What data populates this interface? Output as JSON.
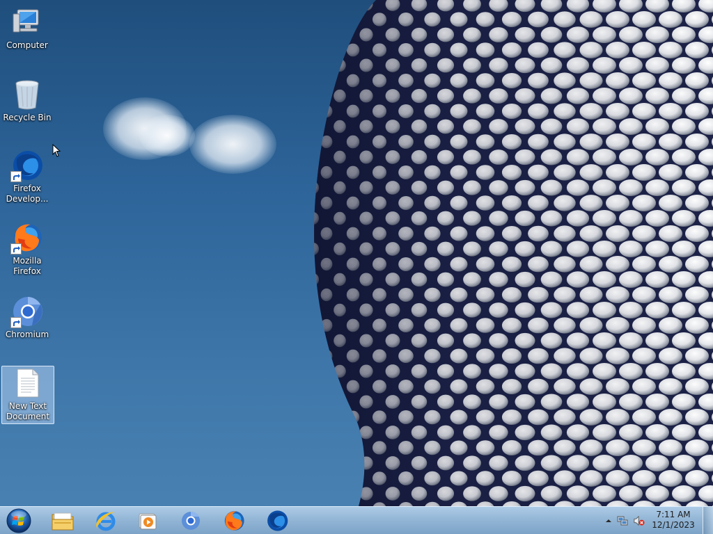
{
  "desktop": {
    "icons": [
      {
        "label": "Computer",
        "icon": "computer-icon",
        "shortcut": false
      },
      {
        "label": "Recycle Bin",
        "icon": "recycle-bin-icon",
        "shortcut": false
      },
      {
        "label": "Firefox\nDevelop...",
        "icon": "firefox-developer-icon",
        "shortcut": true
      },
      {
        "label": "Mozilla\nFirefox",
        "icon": "firefox-icon",
        "shortcut": true
      },
      {
        "label": "Chromium",
        "icon": "chromium-icon",
        "shortcut": true
      },
      {
        "label": "New Text\nDocument",
        "icon": "text-document-icon",
        "shortcut": false,
        "selected": true
      }
    ]
  },
  "taskbar": {
    "start": {
      "icon": "windows-start-icon"
    },
    "pinned": [
      {
        "name": "windows-explorer",
        "icon": "folder-icon"
      },
      {
        "name": "internet-explorer",
        "icon": "internet-explorer-icon"
      },
      {
        "name": "windows-media-player",
        "icon": "media-player-icon"
      },
      {
        "name": "chromium",
        "icon": "chromium-icon"
      },
      {
        "name": "firefox",
        "icon": "firefox-icon"
      },
      {
        "name": "firefox-developer",
        "icon": "firefox-developer-icon"
      }
    ],
    "tray": {
      "icons": [
        "show-hidden-icons-arrow",
        "network-icon",
        "volume-muted-icon"
      ],
      "time": "7:11 AM",
      "date": "12/1/2023"
    }
  },
  "colors": {
    "sky_top": "#1f4e7c",
    "sky_bottom": "#4a83b3",
    "taskbar": "#94b6d6",
    "selection": "#c8e1ff"
  }
}
